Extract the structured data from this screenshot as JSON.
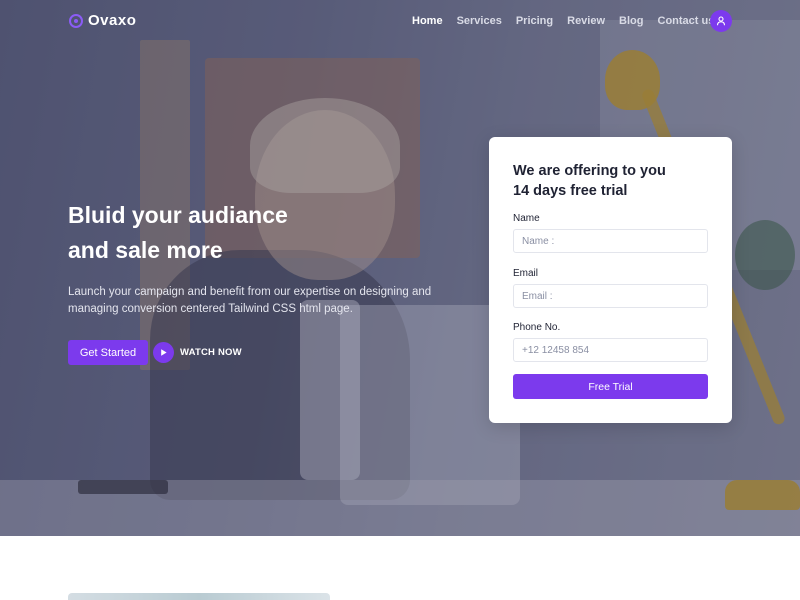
{
  "brand": {
    "name": "Ovaxo",
    "accent": "#7c3aed"
  },
  "nav": {
    "items": [
      {
        "label": "Home",
        "active": true
      },
      {
        "label": "Services"
      },
      {
        "label": "Pricing"
      },
      {
        "label": "Review"
      },
      {
        "label": "Blog"
      },
      {
        "label": "Contact us"
      }
    ],
    "user_icon": "user-icon"
  },
  "hero": {
    "title_line1": "Bluid your audiance",
    "title_line2": "and sale more",
    "subtitle_line1": "Launch your campaign and benefit from our expertise on designing and",
    "subtitle_line2": "managing conversion centered Tailwind CSS html page.",
    "cta_primary": "Get Started",
    "cta_secondary": "WATCH NOW",
    "play_icon": "play-icon"
  },
  "trial_form": {
    "title_line1": "We are offering to you",
    "title_line2": "14 days free trial",
    "fields": [
      {
        "label": "Name",
        "placeholder": "Name :"
      },
      {
        "label": "Email",
        "placeholder": "Email :"
      },
      {
        "label": "Phone No.",
        "placeholder": "+12 12458 854"
      }
    ],
    "submit": "Free Trial"
  }
}
